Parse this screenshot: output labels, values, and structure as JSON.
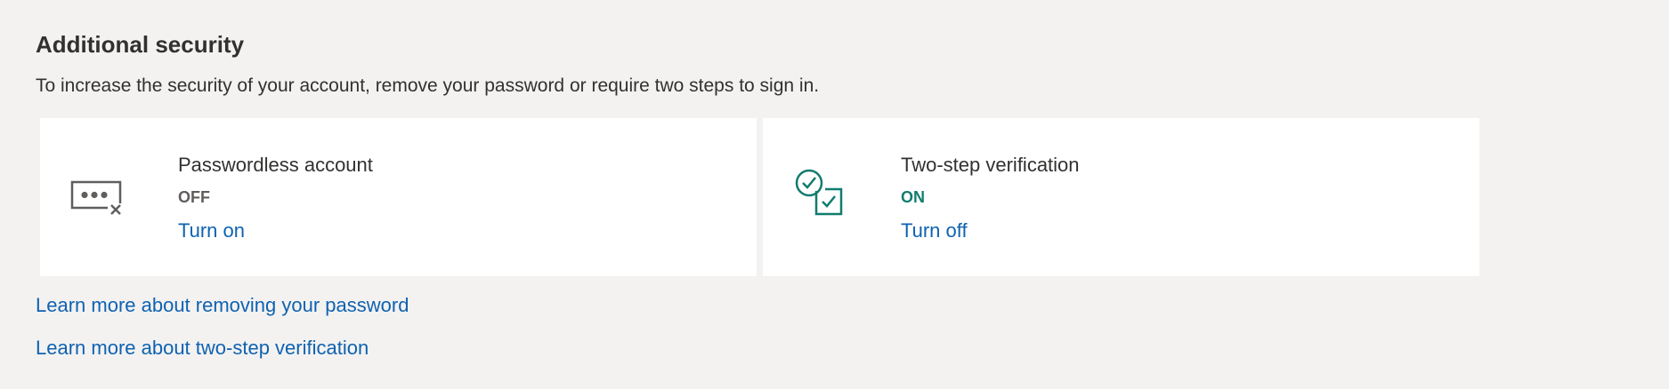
{
  "section": {
    "title": "Additional security",
    "description": "To increase the security of your account, remove your password or require two steps to sign in."
  },
  "cards": [
    {
      "icon": "password-removed-icon",
      "title": "Passwordless account",
      "status": "OFF",
      "action": "Turn on"
    },
    {
      "icon": "two-step-verification-icon",
      "title": "Two-step verification",
      "status": "ON",
      "action": "Turn off"
    }
  ],
  "links": {
    "remove_password": "Learn more about removing your password",
    "two_step": "Learn more about two-step verification"
  },
  "colors": {
    "background": "#f3f2f1",
    "card": "#ffffff",
    "link": "#0f62b0",
    "status_on": "#107c6e",
    "status_off": "#605e5c",
    "icon_gray": "#605e5c",
    "icon_teal": "#107c6e"
  }
}
